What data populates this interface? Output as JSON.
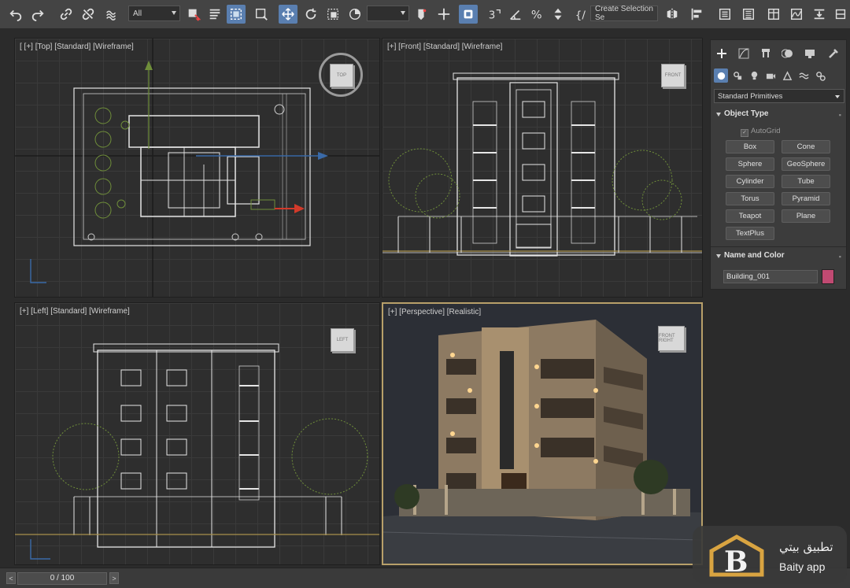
{
  "toolbar": {
    "filter_value": "All",
    "named_selection_value": "",
    "create_selection_label": "Create Selection Se",
    "icons": [
      "undo-icon",
      "redo-icon",
      "link-icon",
      "unlink-icon",
      "bind-spacewarp-icon",
      "select-object-icon",
      "select-by-name-icon",
      "rectangular-selection-icon",
      "window-crossing-icon",
      "move-icon",
      "rotate-icon",
      "scale-icon",
      "reference-coordinate-icon",
      "pivot-icon",
      "snap-icon",
      "angle-snap-icon",
      "percent-snap-icon",
      "spinner-snap-icon",
      "mirror-icon",
      "align-icon",
      "layer-explorer-icon",
      "scene-explorer-icon",
      "ribbon-icon",
      "curve-editor-icon",
      "render-setup-icon"
    ]
  },
  "viewports": {
    "top": {
      "label": "[  [+] [Top] [Standard] [Wireframe]",
      "cube_label": "TOP"
    },
    "front": {
      "label": "[+] [Front] [Standard] [Wireframe]",
      "cube_label": "FRONT"
    },
    "left": {
      "label": "[+] [Left] [Standard] [Wireframe]",
      "cube_label": "LEFT"
    },
    "perspective": {
      "label": "[+] [Perspective] [Realistic]",
      "cube_label": "FRONT  RIGHT"
    }
  },
  "command_panel": {
    "category_dropdown": "Standard Primitives",
    "object_type": {
      "title": "Object Type",
      "autogrid_label": "AutoGrid",
      "buttons": [
        "Box",
        "Cone",
        "Sphere",
        "GeoSphere",
        "Cylinder",
        "Tube",
        "Torus",
        "Pyramid",
        "Teapot",
        "Plane",
        "TextPlus"
      ]
    },
    "name_and_color": {
      "title": "Name and Color",
      "object_name": "Building_001",
      "color": "#c04a72"
    }
  },
  "status_bar": {
    "time_slider": "0 / 100",
    "prev_label": "<",
    "next_label": ">"
  },
  "watermark": {
    "arabic_text": "تطبيق بيتي",
    "latin_text": "Baity app",
    "logo_letter": "B"
  },
  "colors": {
    "accent_blue": "#5a7fb0",
    "active_viewport_border": "#b8a06a",
    "wireframe": "#e6e6e6",
    "wire_green": "#6f8e3a"
  }
}
